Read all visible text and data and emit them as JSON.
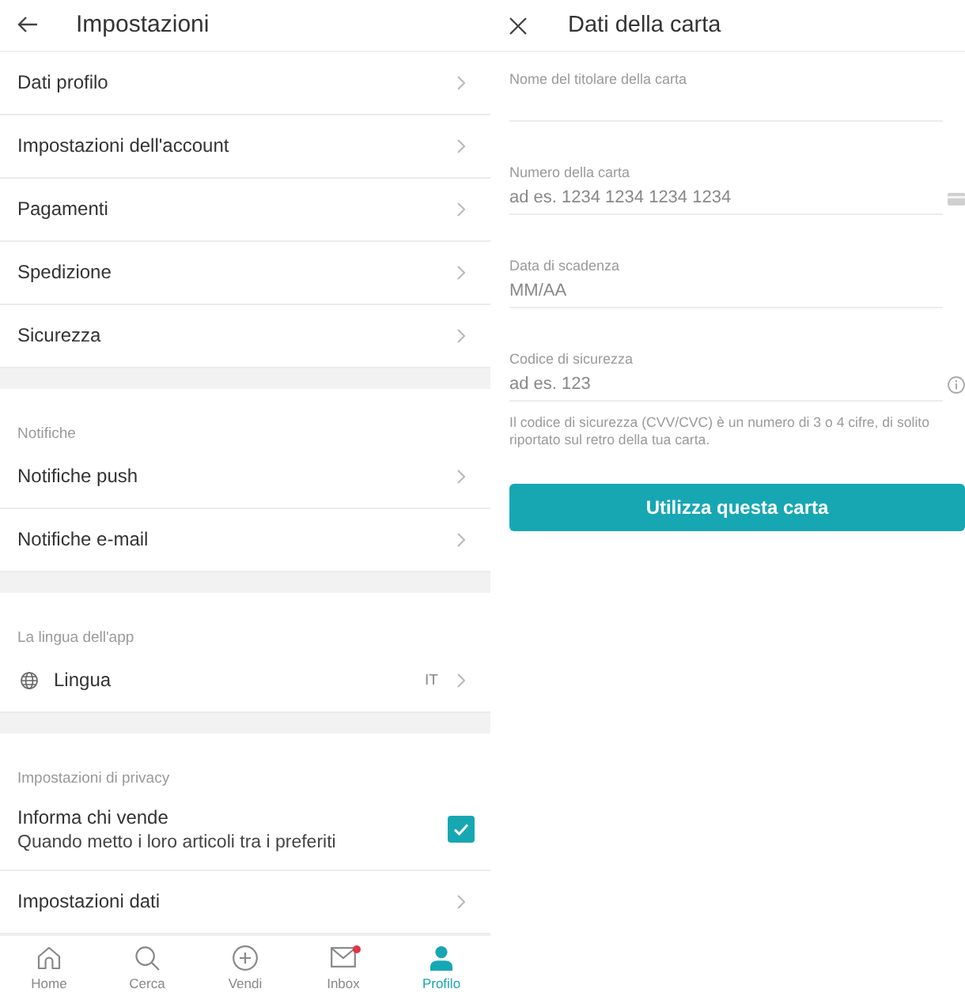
{
  "settings": {
    "title": "Impostazioni",
    "sections": [
      {
        "items": [
          {
            "kind": "link",
            "label": "Dati profilo"
          },
          {
            "kind": "link",
            "label": "Impostazioni dell'account"
          },
          {
            "kind": "link",
            "label": "Pagamenti"
          },
          {
            "kind": "link",
            "label": "Spedizione"
          },
          {
            "kind": "link",
            "label": "Sicurezza"
          }
        ]
      },
      {
        "heading": "Notifiche",
        "items": [
          {
            "kind": "link",
            "label": "Notifiche push"
          },
          {
            "kind": "link",
            "label": "Notifiche e-mail"
          }
        ]
      },
      {
        "heading": "La lingua dell'app",
        "items": [
          {
            "kind": "language",
            "label": "Lingua",
            "value": "IT"
          }
        ]
      },
      {
        "heading": "Impostazioni di privacy",
        "items": [
          {
            "kind": "checkbox",
            "label": "Informa chi vende",
            "description": "Quando metto i loro articoli tra i preferiti",
            "checked": true
          },
          {
            "kind": "link",
            "label": "Impostazioni dati"
          }
        ]
      }
    ]
  },
  "bottom_nav": {
    "items": [
      {
        "kind": "home",
        "label": "Home",
        "selected": false,
        "unread": false
      },
      {
        "kind": "search",
        "label": "Cerca",
        "selected": false,
        "unread": false
      },
      {
        "kind": "sell",
        "label": "Vendi",
        "selected": false,
        "unread": false
      },
      {
        "kind": "inbox",
        "label": "Inbox",
        "selected": false,
        "unread": true
      },
      {
        "kind": "profile",
        "label": "Profilo",
        "selected": true,
        "unread": false
      }
    ]
  },
  "card_form": {
    "title": "Dati della carta",
    "fields": [
      {
        "kind": "text",
        "label": "Nome del titolare della carta"
      },
      {
        "kind": "card_number",
        "label": "Numero della carta",
        "placeholder": "ad es. 1234 1234 1234 1234"
      },
      {
        "kind": "expiry",
        "label": "Data di scadenza",
        "placeholder": "MM/AA"
      },
      {
        "kind": "security_code",
        "label": "Codice di sicurezza",
        "placeholder": "ad es. 123",
        "hint": "Il codice di sicurezza (CVV/CVC) è un numero di 3 o 4 cifre, di solito riportato sul retro della tua carta."
      }
    ],
    "submit_button": "Utilizza questa carta"
  }
}
